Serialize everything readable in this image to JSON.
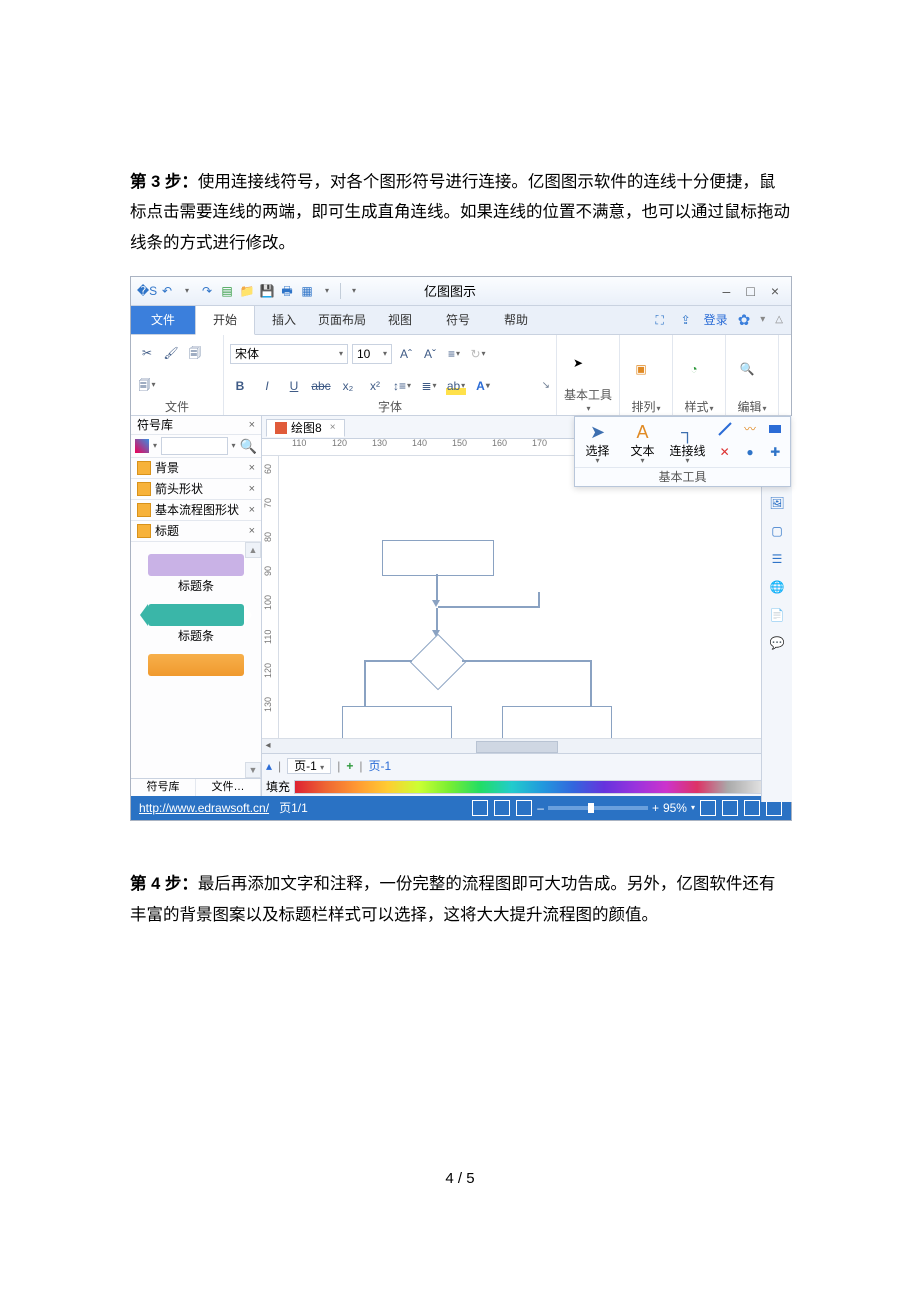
{
  "document": {
    "step3_label": "第 3 步：",
    "step3_text": "使用连接线符号，对各个图形符号进行连接。亿图图示软件的连线十分便捷，鼠标点击需要连线的两端，即可生成直角连线。如果连线的位置不满意，也可以通过鼠标拖动线条的方式进行修改。",
    "step4_label": "第 4 步：",
    "step4_text": "最后再添加文字和注释，一份完整的流程图即可大功告成。另外，亿图软件还有丰富的背景图案以及标题栏样式可以选择，这将大大提升流程图的颜值。",
    "page_footer": "4 / 5"
  },
  "app": {
    "title": "亿图图示",
    "window_buttons": {
      "min": "–",
      "max": "□",
      "close": "×"
    },
    "tabs": {
      "file": "文件",
      "start": "开始",
      "insert": "插入",
      "layout": "页面布局",
      "view": "视图",
      "symbol": "符号",
      "help": "帮助"
    },
    "top_right": {
      "login": "登录"
    },
    "ribbon": {
      "file_group": "文件",
      "font_group": "字体",
      "font_name": "宋体",
      "font_size": "10",
      "basic_tools": "基本工具",
      "arrange": "排列",
      "style": "样式",
      "edit": "编辑"
    },
    "sym_panel": {
      "title": "符号库",
      "sections": {
        "bg": "背景",
        "arrow": "箭头形状",
        "flow": "基本流程图形状",
        "title": "标题"
      },
      "thumb_label": "标题条",
      "tabs": {
        "lib": "符号库",
        "file": "文件…"
      }
    },
    "doc_tab": {
      "name": "绘图8",
      "close": "×"
    },
    "ruler_ticks": [
      "110",
      "120",
      "130",
      "140",
      "150",
      "160",
      "170"
    ],
    "vruler_ticks": [
      "60",
      "70",
      "80",
      "90",
      "100",
      "110",
      "120",
      "130"
    ],
    "float_tools": {
      "select": "选择",
      "text": "文本",
      "connect": "连接线",
      "label": "基本工具"
    },
    "page_tabs": {
      "page": "页-1",
      "plus": "+",
      "page_active": "页-1"
    },
    "fill_label": "填充",
    "status": {
      "url": "http://www.edrawsoft.cn/",
      "page": "页1/1",
      "zoom": "95%"
    }
  }
}
